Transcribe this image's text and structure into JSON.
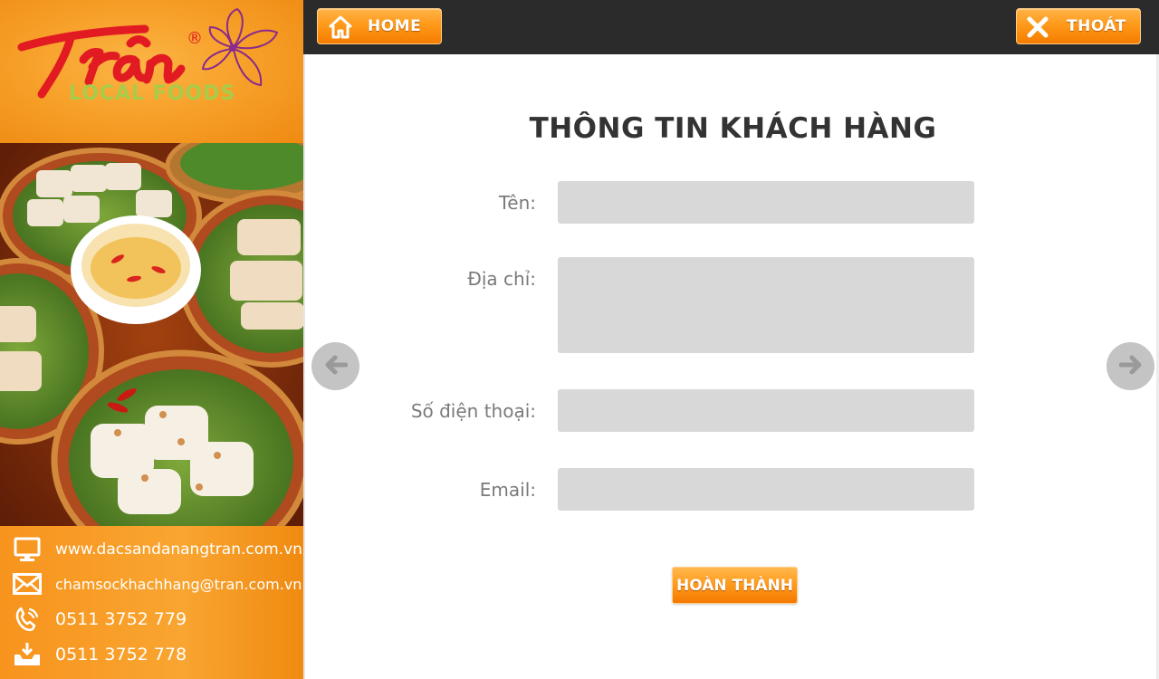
{
  "brand": {
    "logo_main": "Trần",
    "logo_sub": "LOCAL FOODS",
    "registered_mark": "®",
    "colors": {
      "red": "#e21b23",
      "green": "#9bc53d",
      "purple": "#8b2a8a",
      "orange": "#f7941d"
    }
  },
  "topbar": {
    "home_label": "HOME",
    "home_icon": "house-icon",
    "exit_label": "THOÁT",
    "exit_icon": "close-x-icon"
  },
  "contacts": [
    {
      "icon": "monitor-icon",
      "text": "www.dacsandanangtran.com.vn"
    },
    {
      "icon": "envelope-icon",
      "text": "chamsockhachhang@tran.com.vn"
    },
    {
      "icon": "phone-icon",
      "text": "0511 3752 779"
    },
    {
      "icon": "fax-tray-icon",
      "text": "0511 3752 778"
    }
  ],
  "form": {
    "title": "THÔNG TIN KHÁCH HÀNG",
    "name_label": "Tên:",
    "name_value": "",
    "address_label": "Địa chỉ:",
    "address_value": "",
    "phone_label": "Số điện thoại:",
    "phone_value": "",
    "email_label": "Email:",
    "email_value": "",
    "submit_label": "HOÀN THÀNH"
  },
  "nav": {
    "prev_icon": "arrow-left-icon",
    "next_icon": "arrow-right-icon"
  }
}
